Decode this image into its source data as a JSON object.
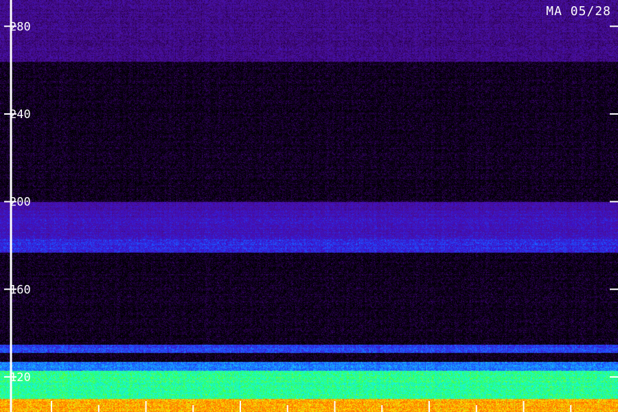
{
  "chart_data": {
    "type": "heatmap",
    "title": "",
    "station_label": "MA 05/28",
    "ylabel": "",
    "xlabel": "",
    "ylim": [
      104,
      292
    ],
    "y_ticks": [
      120,
      160,
      200,
      240,
      280
    ],
    "x_tick_count": 12,
    "colormap": [
      "#000000",
      "#2a0050",
      "#4b1098",
      "#3d10c8",
      "#1d4cff",
      "#18a8ff",
      "#18ffd8",
      "#30ff50",
      "#ffee00",
      "#ff7000"
    ],
    "bands": [
      {
        "y_range": [
          104,
          110
        ],
        "intensity": 0.95
      },
      {
        "y_range": [
          110,
          123
        ],
        "intensity": 0.72
      },
      {
        "y_range": [
          123,
          127
        ],
        "intensity": 0.5
      },
      {
        "y_range": [
          131,
          135
        ],
        "intensity": 0.42
      },
      {
        "y_range": [
          177,
          183
        ],
        "intensity": 0.38
      },
      {
        "y_range": [
          183,
          196
        ],
        "intensity": 0.3
      },
      {
        "y_range": [
          196,
          200
        ],
        "intensity": 0.26
      },
      {
        "y_range": [
          264,
          292
        ],
        "intensity": 0.2
      }
    ]
  }
}
